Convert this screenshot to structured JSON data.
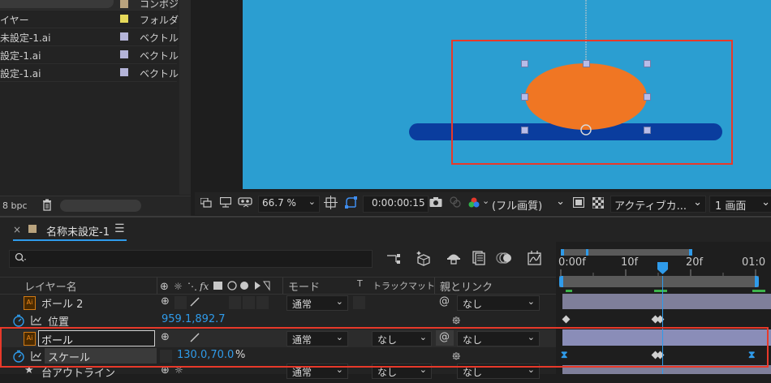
{
  "project": {
    "items": [
      {
        "name": "",
        "type": "コンポジ",
        "color": "#b9a37e"
      },
      {
        "name": "イヤー",
        "type": "フォルダ",
        "color": "#e6d95a"
      },
      {
        "name": "未設定-1.ai",
        "type": "ベクトル",
        "color": "#b4b4d8"
      },
      {
        "name": "設定-1.ai",
        "type": "ベクトル",
        "color": "#b4b4d8"
      },
      {
        "name": "設定-1.ai",
        "type": "ベクトル",
        "color": "#b4b4d8"
      }
    ],
    "footer": {
      "bpc": "8 bpc"
    }
  },
  "viewer": {
    "canvas_color": "#2b9ed1",
    "zoom": "66.7 %",
    "timecode": "0:00:00:15",
    "resolution": "(フル画質)",
    "view": "アクティブカ...",
    "views_count": "1 画面"
  },
  "timeline": {
    "tab_title": "名称未設定-1",
    "search_placeholder": "",
    "columns": {
      "layer_name": "レイヤー名",
      "mode": "モード",
      "t": "T",
      "track_matte": "トラックマット",
      "parent": "親とリンク"
    },
    "ruler": [
      "0:00f",
      "10f",
      "20f",
      "01:0"
    ],
    "layers": [
      {
        "name": "ボール 2",
        "mode": "通常",
        "matte": "",
        "parent": "なし"
      },
      {
        "property": "位置",
        "value": "959.1,892.7"
      },
      {
        "name": "ボール",
        "mode": "通常",
        "matte": "なし",
        "parent": "なし"
      },
      {
        "property": "スケール",
        "value": "130.0,70.0",
        "unit": "%"
      },
      {
        "name": "台アウトライン",
        "mode": "通常",
        "matte": "なし",
        "parent": "なし"
      }
    ]
  }
}
